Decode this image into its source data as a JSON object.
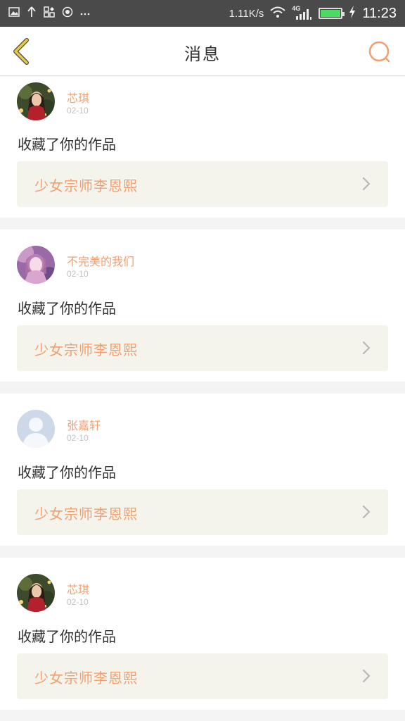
{
  "status_bar": {
    "speed": "1.11K/s",
    "network": "4G",
    "time": "11:23",
    "icons": [
      "image-icon",
      "upload-icon",
      "app-icon",
      "record-icon",
      "more-icon",
      "wifi-icon",
      "signal-icon",
      "battery-icon",
      "charging-icon"
    ]
  },
  "header": {
    "title": "消息",
    "back_icon": "chevron-left-icon",
    "search_icon": "search-icon"
  },
  "colors": {
    "accent": "#f0a070",
    "back_icon": "#e8c94a",
    "work_box_bg": "#f4f3ec"
  },
  "messages": [
    {
      "username": "芯琪",
      "date": "02-10",
      "action": "收藏了你的作品",
      "work_title": "少女宗师李恩熙",
      "avatar": "photo-avatar"
    },
    {
      "username": "不完美的我们",
      "date": "02-10",
      "action": "收藏了你的作品",
      "work_title": "少女宗师李恩熙",
      "avatar": "photo-avatar"
    },
    {
      "username": "张嘉轩",
      "date": "02-10",
      "action": "收藏了你的作品",
      "work_title": "少女宗师李恩熙",
      "avatar": "default-avatar"
    },
    {
      "username": "芯琪",
      "date": "02-10",
      "action": "收藏了你的作品",
      "work_title": "少女宗师李恩熙",
      "avatar": "photo-avatar"
    }
  ]
}
